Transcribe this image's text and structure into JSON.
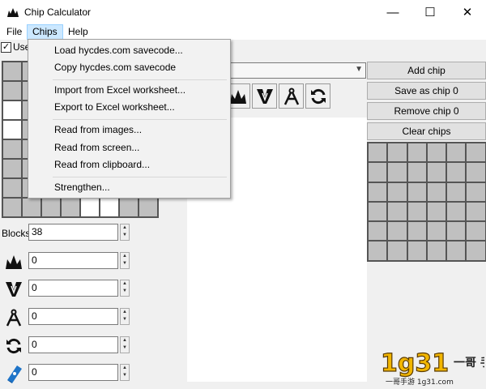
{
  "window": {
    "title": "Chip Calculator",
    "minimize": "—",
    "maximize": "☐",
    "close": "✕"
  },
  "menu": {
    "file": "File",
    "chips": "Chips",
    "help": "Help"
  },
  "options": {
    "use_label": "Use",
    "checked": "✓"
  },
  "chips_menu": {
    "load": "Load hycdes.com savecode...",
    "copy": "Copy hycdes.com savecode",
    "import": "Import from Excel worksheet...",
    "export": "Export to Excel worksheet...",
    "images": "Read from images...",
    "screen": "Read from screen...",
    "clipboard": "Read from clipboard...",
    "strengthen": "Strengthen..."
  },
  "buttons": {
    "add": "Add chip",
    "save": "Save as chip 0",
    "remove": "Remove chip 0",
    "clear": "Clear chips"
  },
  "fields": {
    "blocks_label": "Blocks",
    "blocks": "38",
    "damage": "0",
    "breach": "0",
    "accuracy": "0",
    "reload": "0",
    "exp": "0"
  },
  "icons": {
    "app": "crown-icon",
    "damage": "crown-icon",
    "breach": "breach-icon",
    "accuracy": "compass-icon",
    "reload": "reload-icon",
    "exp": "book-icon"
  },
  "watermark": {
    "number": "1g31",
    "brand": "一哥 手游",
    "url": "一哥手游 1g31.com"
  },
  "colors": {
    "cell_gray": "#c0c0c0",
    "menu_highlight": "#cce8ff"
  }
}
